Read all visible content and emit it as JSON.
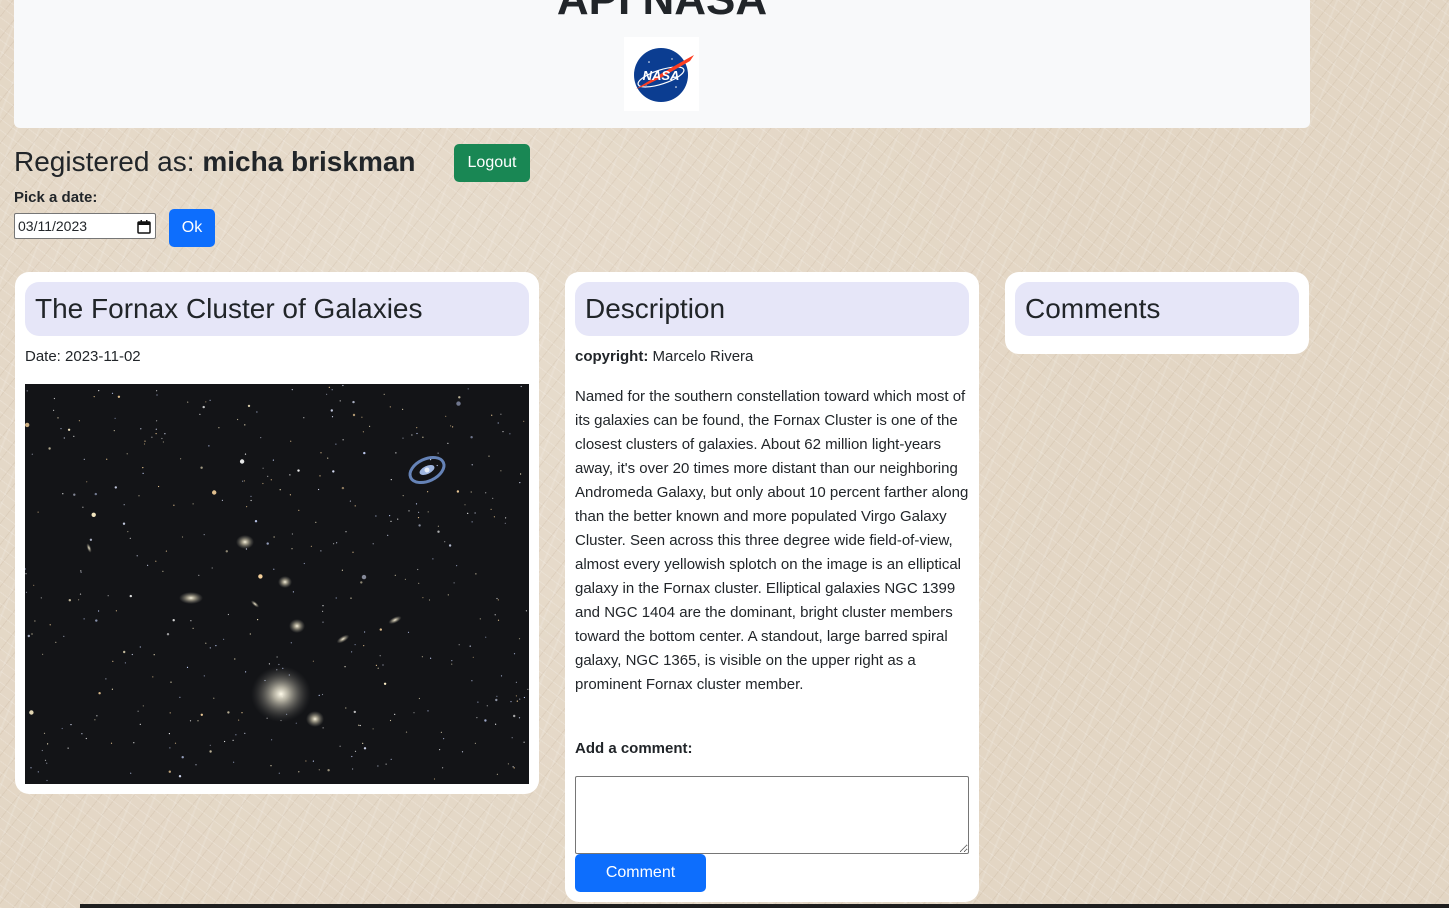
{
  "header": {
    "title": "API NASA",
    "logo_icon": "nasa-logo-icon"
  },
  "user": {
    "prefix": "Registered as: ",
    "name": "micha briskman",
    "logout_label": "Logout"
  },
  "date_picker": {
    "label": "Pick a date:",
    "value": "03/11/2023",
    "ok_label": "Ok"
  },
  "apod": {
    "title": "The Fornax Cluster of Galaxies",
    "date": "Date: 2023-11-02"
  },
  "description": {
    "title": "Description",
    "copyright_label": "copyright:",
    "copyright_value": " Marcelo Rivera",
    "explanation": "Named for the southern constellation toward which most of its galaxies can be found, the Fornax Cluster is one of the closest clusters of galaxies. About 62 million light-years away, it's over 20 times more distant than our neighboring Andromeda Galaxy, but only about 10 percent farther along than the better known and more populated Virgo Galaxy Cluster. Seen across this three degree wide field-of-view, almost every yellowish splotch on the image is an elliptical galaxy in the Fornax cluster. Elliptical galaxies NGC 1399 and NGC 1404 are the dominant, bright cluster members toward the bottom center. A standout, large barred spiral galaxy, NGC 1365, is visible on the upper right as a prominent Fornax cluster member.",
    "add_comment_label": "Add a comment:",
    "comment_value": "",
    "comment_button": "Comment"
  },
  "comments": {
    "title": "Comments"
  },
  "colors": {
    "primary": "#0d6efd",
    "success": "#198754",
    "card_title_bg": "#e6e6f8"
  }
}
